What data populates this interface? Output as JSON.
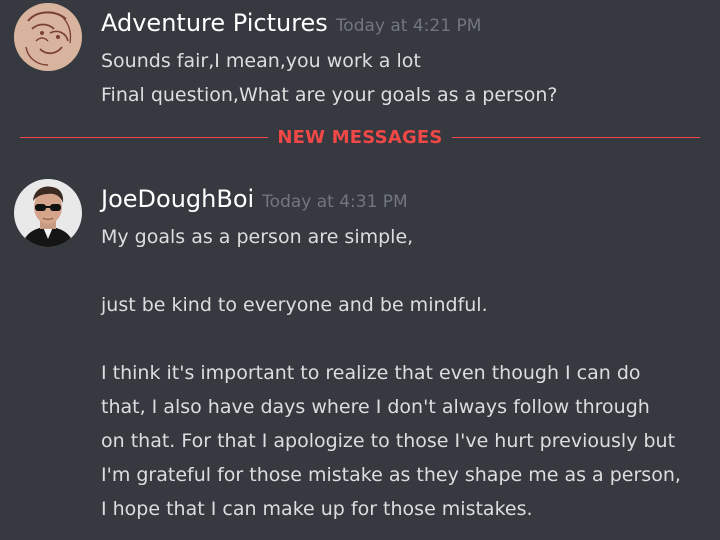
{
  "messages": [
    {
      "username": "Adventure Pictures",
      "timestamp": "Today at 4:21 PM",
      "avatar": "sketch-face-avatar",
      "lines": [
        "Sounds fair,I mean,you work a lot",
        "Final question,What are your goals as a person?"
      ]
    },
    {
      "username": "JoeDoughBoi",
      "timestamp": "Today at 4:31 PM",
      "avatar": "man-sunglasses-avatar",
      "lines": [
        "My goals as a person are simple,",
        "",
        "just be kind to everyone and be mindful.",
        "",
        "I think it's important to realize that even though I can do",
        "that, I also have days where I don't always follow through",
        "on that. For that I apologize to those I've hurt previously but",
        "I'm grateful for those mistake as they shape me as a person,",
        "I hope that I can make up for those mistakes."
      ]
    }
  ],
  "divider": {
    "label": "NEW MESSAGES",
    "color": "#f04747"
  },
  "colors": {
    "background": "#36393f",
    "username": "#ffffff",
    "timestamp": "#72767d",
    "text": "#dcddde"
  }
}
